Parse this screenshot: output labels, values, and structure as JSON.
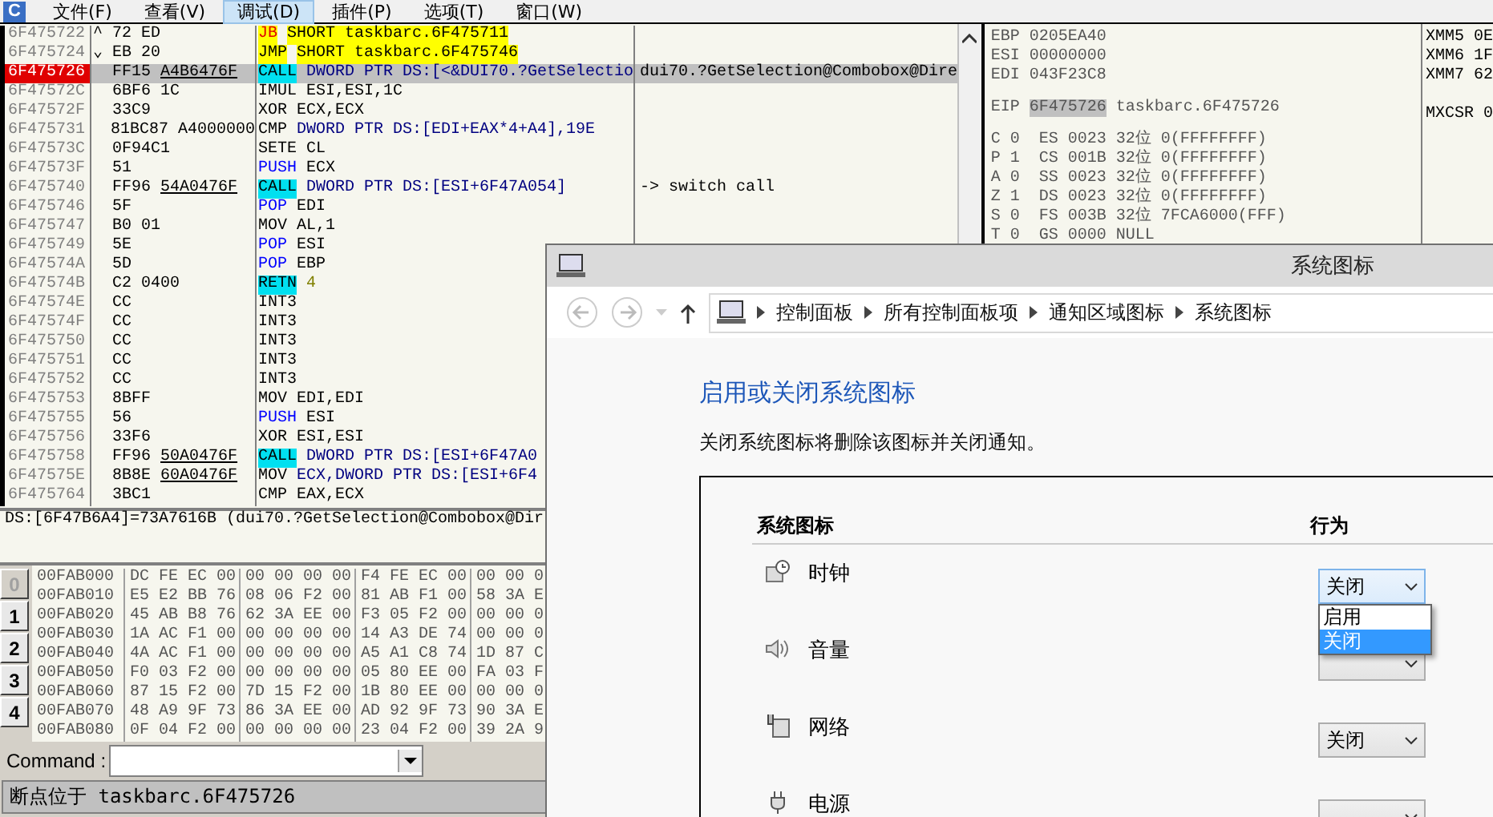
{
  "menu": {
    "logo": "C",
    "items": [
      {
        "label": "文件(F)",
        "selected": false
      },
      {
        "label": "查看(V)",
        "selected": false
      },
      {
        "label": "调试(D)",
        "selected": true
      },
      {
        "label": "插件(P)",
        "selected": false
      },
      {
        "label": "选项(T)",
        "selected": false
      },
      {
        "label": "窗口(W)",
        "selected": false
      }
    ]
  },
  "disassembly": {
    "rows": [
      {
        "address": "6F475722",
        "selected": false,
        "marker": "^",
        "hex": "72 ED",
        "mnemonic": {
          "text": "JB",
          "kind": "cond_jump"
        },
        "operands": {
          "text": "SHORT taskbarc.6F475711",
          "kind": "jump"
        }
      },
      {
        "address": "6F475724",
        "selected": false,
        "marker": "⌄",
        "hex": "EB 20",
        "mnemonic": {
          "text": "JMP",
          "kind": "jump"
        },
        "operands": {
          "text": "SHORT taskbarc.6F475746",
          "kind": "jump"
        }
      },
      {
        "address": "6F475726",
        "selected": true,
        "hex": "FF15",
        "hex_reloc": "A4B6476F",
        "mnemonic": {
          "text": "CALL",
          "kind": "call"
        },
        "operands": {
          "text": "DWORD PTR DS:[<&DUI70.?GetSelectio",
          "kind": "mem"
        },
        "comment": "dui70.?GetSelection@Combobox@Dire"
      },
      {
        "address": "6F47572C",
        "selected": false,
        "hex": "6BF6 1C",
        "mnemonic": {
          "text": "IMUL",
          "kind": "plain"
        },
        "operands": {
          "text": "ESI,ESI,1C",
          "kind": "plain"
        }
      },
      {
        "address": "6F47572F",
        "selected": false,
        "hex": "33C9",
        "mnemonic": {
          "text": "XOR",
          "kind": "plain"
        },
        "operands": {
          "text": "ECX,ECX",
          "kind": "plain"
        }
      },
      {
        "address": "6F475731",
        "selected": false,
        "hex": "81BC87 A4000000",
        "mnemonic": {
          "text": "CMP",
          "kind": "plain"
        },
        "operands": {
          "text": "DWORD PTR DS:[EDI+EAX*4+A4],19E",
          "kind": "mem"
        }
      },
      {
        "address": "6F47573C",
        "selected": false,
        "hex": "0F94C1",
        "mnemonic": {
          "text": "SETE",
          "kind": "plain"
        },
        "operands": {
          "text": "CL",
          "kind": "plain"
        }
      },
      {
        "address": "6F47573F",
        "selected": false,
        "hex": "51",
        "mnemonic": {
          "text": "PUSH",
          "kind": "stack"
        },
        "operands": {
          "text": "ECX",
          "kind": "plain"
        }
      },
      {
        "address": "6F475740",
        "selected": false,
        "hex": "FF96",
        "hex_reloc": "54A0476F",
        "mnemonic": {
          "text": "CALL",
          "kind": "call"
        },
        "operands": {
          "text": "DWORD PTR DS:[ESI+6F47A054]",
          "kind": "mem"
        },
        "comment": "-> switch call"
      },
      {
        "address": "6F475746",
        "selected": false,
        "hex": "5F",
        "mnemonic": {
          "text": "POP",
          "kind": "stack"
        },
        "operands": {
          "text": "EDI",
          "kind": "plain"
        }
      },
      {
        "address": "6F475747",
        "selected": false,
        "hex": "B0 01",
        "mnemonic": {
          "text": "MOV",
          "kind": "plain"
        },
        "operands": {
          "text": "AL,1",
          "kind": "plain"
        }
      },
      {
        "address": "6F475749",
        "selected": false,
        "hex": "5E",
        "mnemonic": {
          "text": "POP",
          "kind": "stack"
        },
        "operands": {
          "text": "ESI",
          "kind": "plain"
        }
      },
      {
        "address": "6F47574A",
        "selected": false,
        "hex": "5D",
        "mnemonic": {
          "text": "POP",
          "kind": "stack"
        },
        "operands": {
          "text": "EBP",
          "kind": "plain"
        }
      },
      {
        "address": "6F47574B",
        "selected": false,
        "hex": "C2 0400",
        "mnemonic": {
          "text": "RETN",
          "kind": "call"
        },
        "operands": {
          "text": "4",
          "kind": "const"
        }
      },
      {
        "address": "6F47574E",
        "selected": false,
        "hex": "CC",
        "mnemonic": {
          "text": "INT3",
          "kind": "plain"
        }
      },
      {
        "address": "6F47574F",
        "selected": false,
        "hex": "CC",
        "mnemonic": {
          "text": "INT3",
          "kind": "plain"
        }
      },
      {
        "address": "6F475750",
        "selected": false,
        "hex": "CC",
        "mnemonic": {
          "text": "INT3",
          "kind": "plain"
        }
      },
      {
        "address": "6F475751",
        "selected": false,
        "hex": "CC",
        "mnemonic": {
          "text": "INT3",
          "kind": "plain"
        }
      },
      {
        "address": "6F475752",
        "selected": false,
        "hex": "CC",
        "mnemonic": {
          "text": "INT3",
          "kind": "plain"
        }
      },
      {
        "address": "6F475753",
        "selected": false,
        "hex": "8BFF",
        "mnemonic": {
          "text": "MOV",
          "kind": "plain"
        },
        "operands": {
          "text": "EDI,EDI",
          "kind": "plain"
        }
      },
      {
        "address": "6F475755",
        "selected": false,
        "hex": "56",
        "mnemonic": {
          "text": "PUSH",
          "kind": "stack"
        },
        "operands": {
          "text": "ESI",
          "kind": "plain"
        }
      },
      {
        "address": "6F475756",
        "selected": false,
        "hex": "33F6",
        "mnemonic": {
          "text": "XOR",
          "kind": "plain"
        },
        "operands": {
          "text": "ESI,ESI",
          "kind": "plain"
        }
      },
      {
        "address": "6F475758",
        "selected": false,
        "hex": "FF96",
        "hex_reloc": "50A0476F",
        "mnemonic": {
          "text": "CALL",
          "kind": "call"
        },
        "operands": {
          "text": "DWORD PTR DS:[ESI+6F47A0",
          "kind": "mem"
        }
      },
      {
        "address": "6F47575E",
        "selected": false,
        "hex": "8B8E",
        "hex_reloc": "60A0476F",
        "mnemonic": {
          "text": "MOV",
          "kind": "plain"
        },
        "operands": {
          "text": "ECX,DWORD PTR DS:[ESI+6F4",
          "kind": "mem"
        }
      },
      {
        "address": "6F475764",
        "selected": false,
        "hex": "3BC1",
        "mnemonic": {
          "text": "CMP",
          "kind": "plain"
        },
        "operands": {
          "text": "EAX,ECX",
          "kind": "plain"
        }
      }
    ]
  },
  "registers": {
    "lines": [
      "EBP 0205EA40",
      "ESI 00000000",
      "EDI 043F23C8"
    ],
    "eip": {
      "name": "EIP",
      "value": "6F475726",
      "comment": "taskbarc.6F475726"
    },
    "flags": [
      "C 0  ES 0023 32位 0(FFFFFFFF)",
      "P 1  CS 001B 32位 0(FFFFFFFF)",
      "A 0  SS 0023 32位 0(FFFFFFFF)",
      "Z 1  DS 0023 32位 0(FFFFFFFF)",
      "S 0  FS 003B 32位 7FCA6000(FFF)",
      "T 0  GS 0000 NULL"
    ]
  },
  "xmm_registers": {
    "lines": [
      "XMM5 0E",
      "XMM6 1F",
      "XMM7 62"
    ],
    "mxcsr": "MXCSR 0"
  },
  "info_line": "DS:[6F47B6A4]=73A7616B (dui70.?GetSelection@Combobox@Dir",
  "dump": {
    "tabs": [
      {
        "label": "0",
        "selected": true
      },
      {
        "label": "1",
        "selected": false
      },
      {
        "label": "2",
        "selected": false
      },
      {
        "label": "3",
        "selected": false
      },
      {
        "label": "4",
        "selected": false
      }
    ],
    "rows": [
      {
        "address": "00FAB000",
        "groups": [
          "DC FE EC 00",
          "00 00 00 00",
          "F4 FE EC 00",
          "00 00 0"
        ]
      },
      {
        "address": "00FAB010",
        "groups": [
          "E5 E2 BB 76",
          "08 06 F2 00",
          "81 AB F1 00",
          "58 3A E"
        ]
      },
      {
        "address": "00FAB020",
        "groups": [
          "45 AB B8 76",
          "62 3A EE 00",
          "F3 05 F2 00",
          "00 00 0"
        ]
      },
      {
        "address": "00FAB030",
        "groups": [
          "1A AC F1 00",
          "00 00 00 00",
          "14 A3 DE 74",
          "00 00 0"
        ]
      },
      {
        "address": "00FAB040",
        "groups": [
          "4A AC F1 00",
          "00 00 00 00",
          "A5 A1 C8 74",
          "1D 87 C"
        ]
      },
      {
        "address": "00FAB050",
        "groups": [
          "F0 03 F2 00",
          "00 00 00 00",
          "05 80 EE 00",
          "FA 03 F"
        ]
      },
      {
        "address": "00FAB060",
        "groups": [
          "87 15 F2 00",
          "7D 15 F2 00",
          "1B 80 EE 00",
          "00 00 0"
        ]
      },
      {
        "address": "00FAB070",
        "groups": [
          "48 A9 9F 73",
          "86 3A EE 00",
          "AD 92 9F 73",
          "90 3A E"
        ]
      },
      {
        "address": "00FAB080",
        "groups": [
          "0F 04 F2 00",
          "00 00 00 00",
          "23 04 F2 00",
          "39 2A 9"
        ]
      }
    ]
  },
  "command_bar": {
    "label": "Command :"
  },
  "status_bar": {
    "text": "断点位于 taskbarc.6F475726"
  },
  "dialog": {
    "title": "系统图标",
    "breadcrumb": [
      "控制面板",
      "所有控制面板项",
      "通知区域图标",
      "系统图标"
    ],
    "heading": "启用或关闭系统图标",
    "description": "关闭系统图标将删除该图标并关闭通知。",
    "table": {
      "columns": [
        "系统图标",
        "行为"
      ],
      "rows": [
        {
          "kind": "clock",
          "name": "时钟",
          "value": "关闭",
          "focused": true
        },
        {
          "kind": "volume",
          "name": "音量",
          "focused": false
        },
        {
          "kind": "network",
          "name": "网络",
          "value": "关闭",
          "focused": false
        },
        {
          "kind": "power",
          "name": "电源",
          "focused": false
        }
      ]
    },
    "dropdown_options": [
      {
        "label": "启用",
        "selected": false
      },
      {
        "label": "关闭",
        "selected": true
      }
    ]
  }
}
